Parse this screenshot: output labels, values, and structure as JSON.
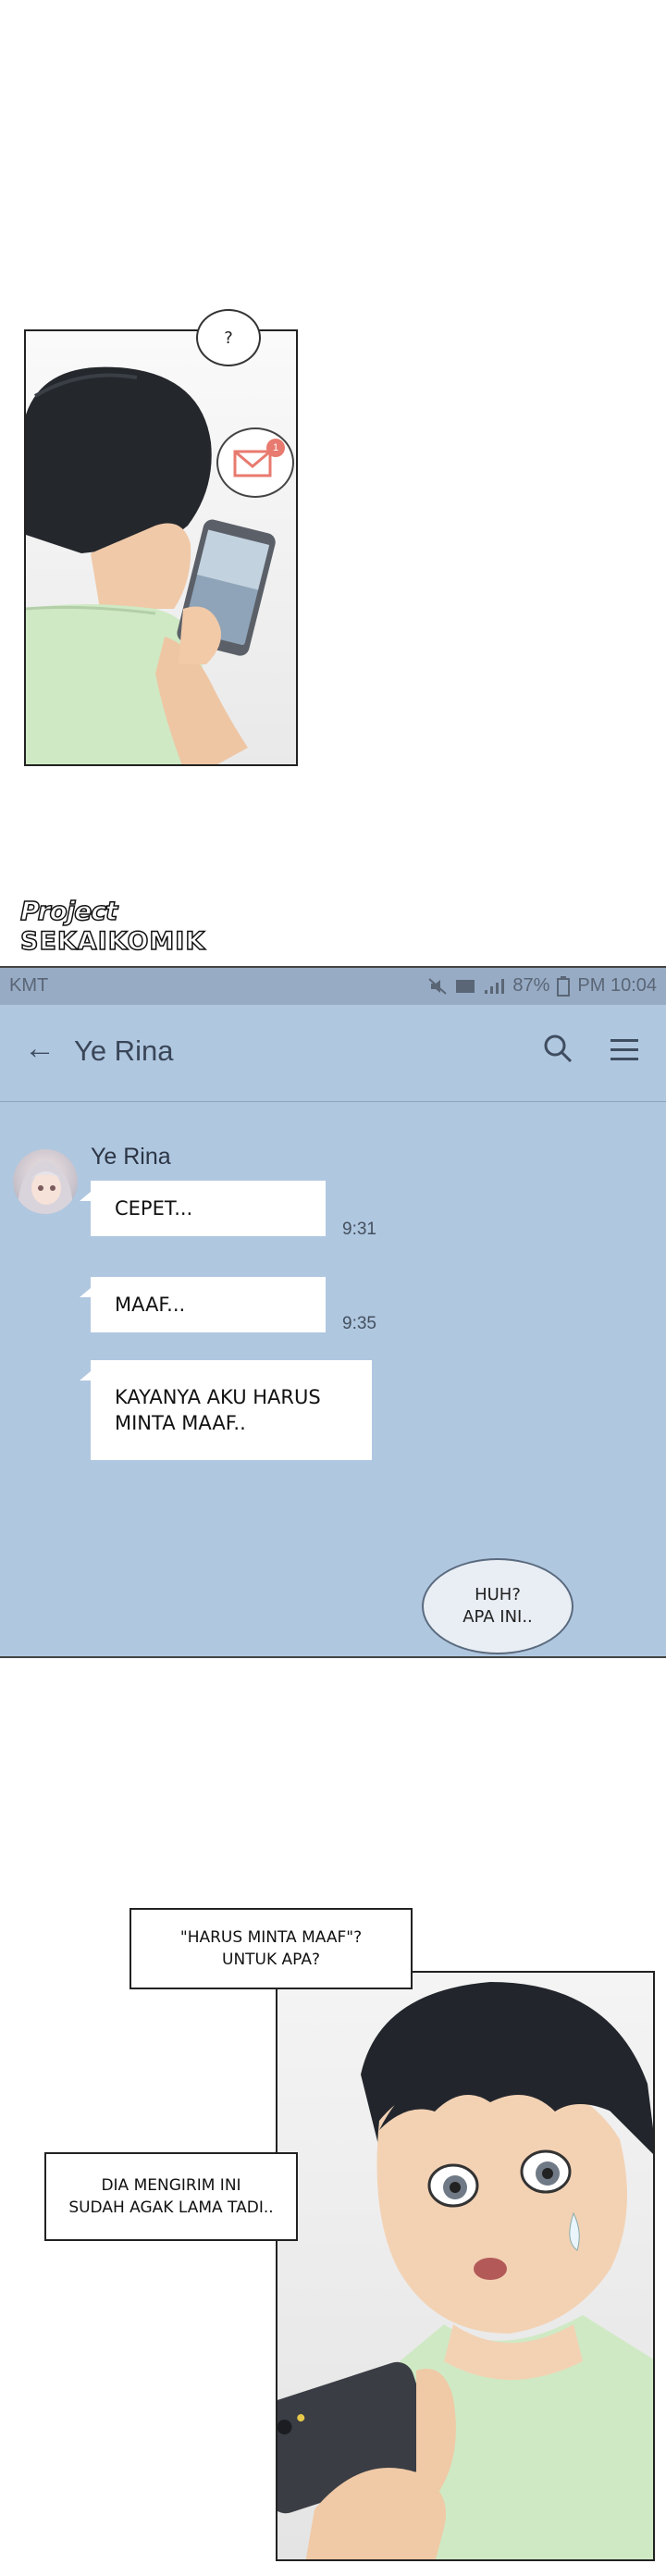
{
  "panel1": {
    "thought_bubble": "?",
    "mail_badge": "1"
  },
  "watermark": {
    "line1": "Project",
    "line2": "SEKAIKOMIK"
  },
  "phone": {
    "status": {
      "carrier": "KMT",
      "battery": "87%",
      "clock": "PM 10:04"
    },
    "chat": {
      "title": "Ye Rina",
      "sender": "Ye Rina",
      "messages": [
        {
          "text": "CEPET...",
          "time": "9:31"
        },
        {
          "text": "MAAF...",
          "time": "9:35"
        },
        {
          "text": "KAYANYA AKU HARUS MINTA MAAF..",
          "time": ""
        }
      ],
      "reply": {
        "line1": "HUH?",
        "line2": "APA INI.."
      }
    },
    "colors": {
      "chat_background": "#b0c7e0",
      "status_bar": "#97abc4"
    }
  },
  "panel2": {
    "caption_top": {
      "line1": "\"HARUS MINTA MAAF\"?",
      "line2": "UNTUK APA?"
    },
    "caption_left": {
      "line1": "DIA MENGIRIM INI",
      "line2": "SUDAH AGAK LAMA TADI.."
    }
  }
}
